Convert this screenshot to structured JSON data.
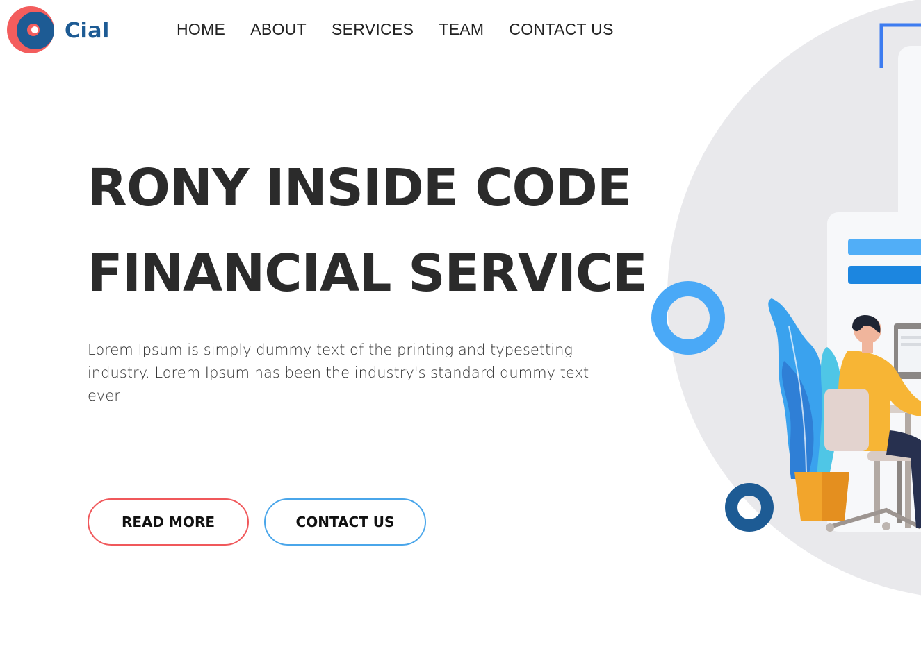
{
  "header": {
    "logo": {
      "text": "Cial",
      "colors": {
        "outer": "#f35d5d",
        "inner": "#1d5b94"
      }
    },
    "nav": [
      "HOME",
      "ABOUT",
      "SERVICES",
      "TEAM",
      "CONTACT US"
    ]
  },
  "hero": {
    "title_line1": "RONY INSIDE CODE",
    "title_line2": "FINANCIAL SERVICE",
    "description": "Lorem Ipsum is simply dummy text of the printing and typesetting industry. Lorem Ipsum has been the industry's standard dummy text ever",
    "buttons": {
      "read_more": "READ MORE",
      "contact_us": "CONTACT US"
    }
  },
  "colors": {
    "accent_red": "#f0585b",
    "accent_blue": "#4aa6ea",
    "brand_dark_blue": "#1d5b94",
    "circle_bg": "#e9e9ec",
    "shirt_orange": "#f7b535"
  },
  "icons": {
    "illustration": "person-at-desk-illustration",
    "ring_light": "blue-ring-decoration",
    "ring_dark": "dark-blue-ring-decoration"
  }
}
